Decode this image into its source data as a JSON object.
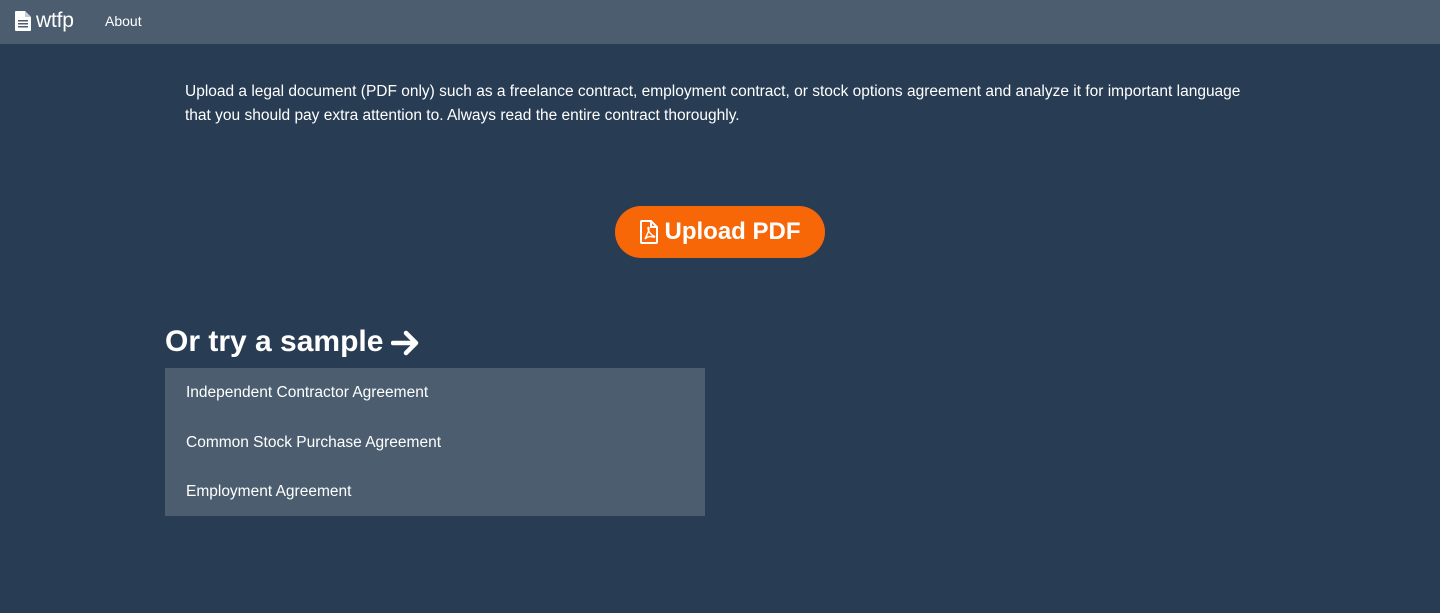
{
  "navbar": {
    "brand_label": "wtfp",
    "brand_icon": "document-icon",
    "links": [
      {
        "label": "About"
      }
    ]
  },
  "main": {
    "intro_text": "Upload a legal document (PDF only) such as a freelance contract, employment contract, or stock options agreement and analyze it for important language that you should pay extra attention to. Always read the entire contract thoroughly.",
    "upload_button": {
      "label": "Upload PDF",
      "icon": "pdf-file-icon",
      "color": "#f76707"
    },
    "samples": {
      "heading": "Or try a sample",
      "heading_icon": "arrow-right-icon",
      "items": [
        {
          "label": "Independent Contractor Agreement"
        },
        {
          "label": "Common Stock Purchase Agreement"
        },
        {
          "label": "Employment Agreement"
        }
      ]
    }
  },
  "colors": {
    "background": "#283c53",
    "navbar": "#4b5d6e",
    "accent": "#f76707",
    "list_background": "#4b5d6e",
    "text": "#ffffff"
  }
}
